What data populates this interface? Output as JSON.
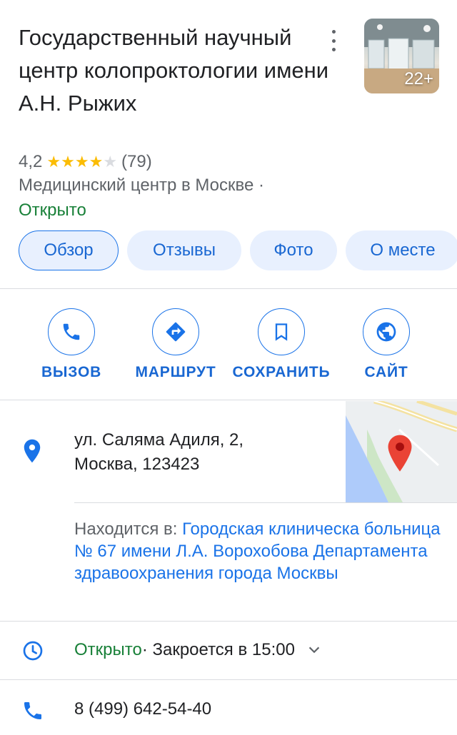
{
  "place": {
    "title": "Государственный научный центр колопроктологии имени А.Н. Рыжих",
    "photo_count": "22+",
    "rating": "4,2",
    "rating_value": 4.2,
    "review_count": "(79)",
    "category": "Медицинский центр в Москве ·",
    "open_status": "Открыто"
  },
  "tabs": [
    {
      "label": "Обзор",
      "active": true
    },
    {
      "label": "Отзывы",
      "active": false
    },
    {
      "label": "Фото",
      "active": false
    },
    {
      "label": "О месте",
      "active": false
    }
  ],
  "actions": [
    {
      "label": "ВЫЗОВ",
      "icon": "phone-icon"
    },
    {
      "label": "МАРШРУТ",
      "icon": "directions-icon"
    },
    {
      "label": "СОХРАНИТЬ",
      "icon": "bookmark-icon"
    },
    {
      "label": "САЙТ",
      "icon": "globe-icon"
    }
  ],
  "details": {
    "address_line1": "ул. Саляма Адиля, 2,",
    "address_line2": "Москва, 123423",
    "located_in_prefix": "Находится в:",
    "located_in_link": "Городская клиническа больница № 67 имени Л.А. Ворохобова Департамента здравоохранения города Москвы",
    "hours_open": "Открыто",
    "hours_close": " · Закроется в 15:00",
    "phone": "8 (499) 642-54-40"
  },
  "colors": {
    "accent": "#1a73e8",
    "open_green": "#188038",
    "star_yellow": "#fbbc04",
    "map_pin_red": "#ea4335"
  }
}
